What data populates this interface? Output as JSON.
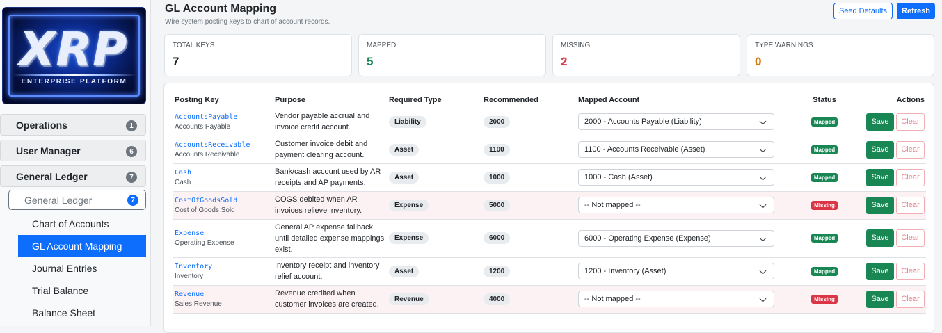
{
  "app": {
    "logo_text": "XRP",
    "logo_subtitle": "ENTERPRISE PLATFORM"
  },
  "sidebar": {
    "groups": [
      {
        "label": "Operations",
        "badge": "1"
      },
      {
        "label": "User Manager",
        "badge": "6"
      },
      {
        "label": "General Ledger",
        "badge": "7"
      }
    ],
    "sub_group": {
      "label": "General Ledger",
      "badge": "7"
    },
    "items": [
      {
        "label": "Chart of Accounts"
      },
      {
        "label": "GL Account Mapping",
        "active": true
      },
      {
        "label": "Journal Entries"
      },
      {
        "label": "Trial Balance"
      },
      {
        "label": "Balance Sheet"
      }
    ]
  },
  "header": {
    "title": "GL Account Mapping",
    "subtitle": "Wire system posting keys to chart of account records.",
    "seed_label": "Seed Defaults",
    "refresh_label": "Refresh"
  },
  "stats": [
    {
      "label": "TOTAL KEYS",
      "value": "7",
      "color": "#212529"
    },
    {
      "label": "MAPPED",
      "value": "5",
      "color": "#198754"
    },
    {
      "label": "MISSING",
      "value": "2",
      "color": "#dc3545"
    },
    {
      "label": "TYPE WARNINGS",
      "value": "0",
      "color": "#d97706"
    }
  ],
  "table": {
    "columns": [
      "Posting Key",
      "Purpose",
      "Required Type",
      "Recommended",
      "Mapped Account",
      "Status",
      "Actions"
    ],
    "rows": [
      {
        "key": "AccountsPayable",
        "name": "Accounts Payable",
        "purpose": "Vendor payable accrual and invoice credit account.",
        "type": "Liability",
        "recommended": "2000",
        "mapped": "2000 - Accounts Payable (Liability)",
        "status": "Mapped",
        "save": "Save",
        "clear": "Clear"
      },
      {
        "key": "AccountsReceivable",
        "name": "Accounts Receivable",
        "purpose": "Customer invoice debit and payment clearing account.",
        "type": "Asset",
        "recommended": "1100",
        "mapped": "1100 - Accounts Receivable (Asset)",
        "status": "Mapped",
        "save": "Save",
        "clear": "Clear"
      },
      {
        "key": "Cash",
        "name": "Cash",
        "purpose": "Bank/cash account used by AR receipts and AP payments.",
        "type": "Asset",
        "recommended": "1000",
        "mapped": "1000 - Cash (Asset)",
        "status": "Mapped",
        "save": "Save",
        "clear": "Clear"
      },
      {
        "key": "CostOfGoodsSold",
        "name": "Cost of Goods Sold",
        "purpose": "COGS debited when AR invoices relieve inventory.",
        "type": "Expense",
        "recommended": "5000",
        "mapped": "-- Not mapped --",
        "status": "Missing",
        "save": "Save",
        "clear": "Clear"
      },
      {
        "key": "Expense",
        "name": "Operating Expense",
        "purpose": "General AP expense fallback until detailed expense mappings exist.",
        "type": "Expense",
        "recommended": "6000",
        "mapped": "6000 - Operating Expense (Expense)",
        "status": "Mapped",
        "save": "Save",
        "clear": "Clear"
      },
      {
        "key": "Inventory",
        "name": "Inventory",
        "purpose": "Inventory receipt and inventory relief account.",
        "type": "Asset",
        "recommended": "1200",
        "mapped": "1200 - Inventory (Asset)",
        "status": "Mapped",
        "save": "Save",
        "clear": "Clear"
      },
      {
        "key": "Revenue",
        "name": "Sales Revenue",
        "purpose": "Revenue credited when customer invoices are created.",
        "type": "Revenue",
        "recommended": "4000",
        "mapped": "-- Not mapped --",
        "status": "Missing",
        "save": "Save",
        "clear": "Clear"
      }
    ]
  }
}
